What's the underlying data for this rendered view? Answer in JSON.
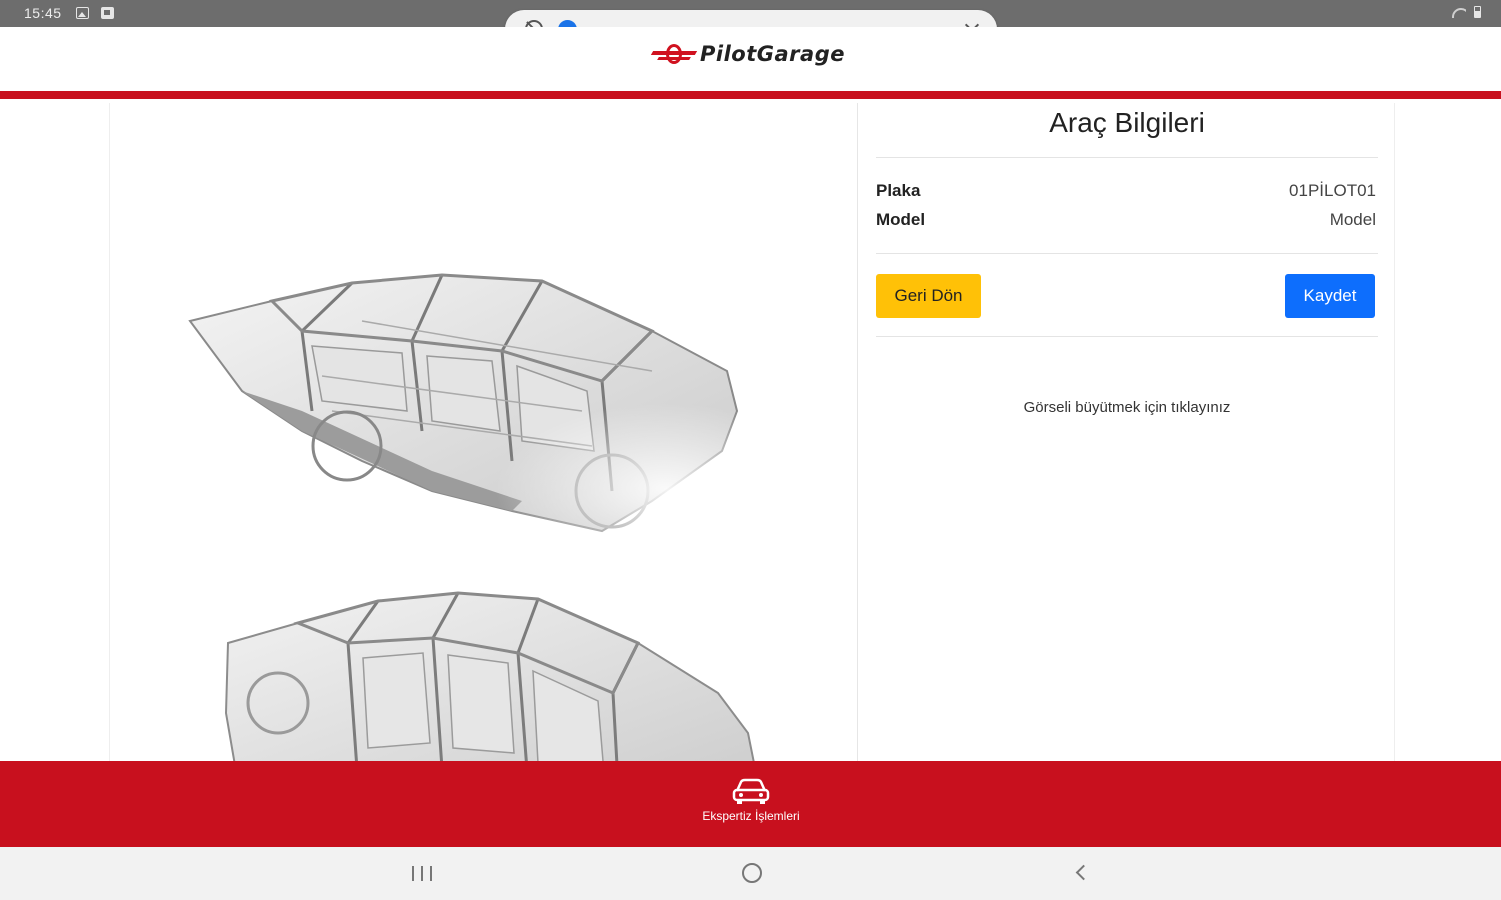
{
  "status_bar": {
    "time": "15:45"
  },
  "header": {
    "logo_text": "PilotGarage",
    "accent_color": "#c8101e"
  },
  "vehicle_panel": {
    "title": "Araç Bilgileri",
    "rows": [
      {
        "label": "Plaka",
        "value": "01PİLOT01"
      },
      {
        "label": "Model",
        "value": "Model"
      }
    ],
    "back_label": "Geri Dön",
    "save_label": "Kaydet",
    "hint": "Görseli büyütmek için tıklayınız"
  },
  "bottom_nav": {
    "items": [
      {
        "label": "Ekspertiz İşlemleri",
        "icon": "car-icon"
      }
    ]
  },
  "colors": {
    "back_button": "#ffc107",
    "save_button": "#0d6efd",
    "brand_red": "#c8101e"
  }
}
